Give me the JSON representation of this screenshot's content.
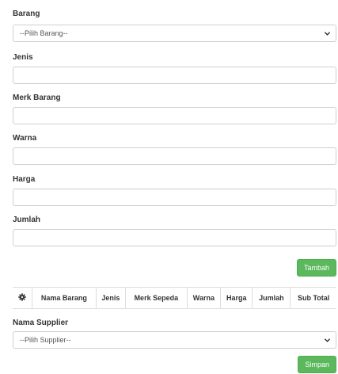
{
  "form": {
    "barang": {
      "label": "Barang",
      "selected": "--Pilih Barang--"
    },
    "jenis": {
      "label": "Jenis",
      "value": ""
    },
    "merk_barang": {
      "label": "Merk Barang",
      "value": ""
    },
    "warna": {
      "label": "Warna",
      "value": ""
    },
    "harga": {
      "label": "Harga",
      "value": ""
    },
    "jumlah": {
      "label": "Jumlah",
      "value": ""
    },
    "tambah_label": "Tambah"
  },
  "table": {
    "settings_icon": "gear-icon",
    "headers": [
      "Nama Barang",
      "Jenis",
      "Merk Sepeda",
      "Warna",
      "Harga",
      "Jumlah",
      "Sub Total"
    ],
    "rows": []
  },
  "supplier": {
    "label": "Nama Supplier",
    "selected": "--Pilih Supplier--"
  },
  "simpan_label": "Simpan",
  "colors": {
    "button_green": "#5cb85c",
    "border": "#cfcfcf"
  }
}
